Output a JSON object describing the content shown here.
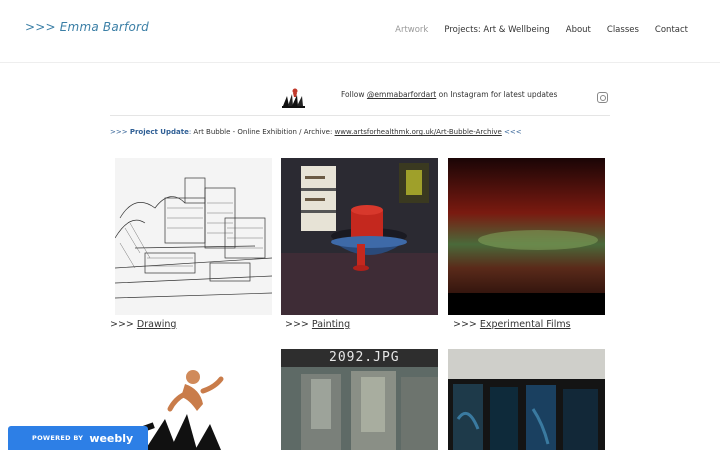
{
  "header": {
    "site_title": ">>> Emma Barford",
    "nav": [
      "Artwork",
      "Projects: Art & Wellbeing",
      "About",
      "Classes",
      "Contact"
    ]
  },
  "follow": {
    "prefix": "Follow ",
    "handle": "@emmabarfordart",
    "suffix": " on Instagram for latest updates"
  },
  "update": {
    "prefix": ">>> ",
    "label": "Project Update",
    "colon": ": ",
    "text": "Art Bubble - Online Exhibition / Archive: ",
    "link": "www.artsforhealthmk.org.uk/Art-Bubble-Archive",
    "suffix": " <<<"
  },
  "gallery": [
    {
      "prefix": ">>> ",
      "label": "Drawing"
    },
    {
      "prefix": ">>> ",
      "label": "Painting"
    },
    {
      "prefix": ">>> ",
      "label": "Experimental Films"
    }
  ],
  "bottom_tiles": {
    "middle_overlay_text": "2092.JPG"
  },
  "footer": {
    "powered_by": "POWERED BY",
    "brand": "weebly"
  },
  "colors": {
    "accent": "#3b7fa6",
    "weebly": "#2d7fe6"
  }
}
